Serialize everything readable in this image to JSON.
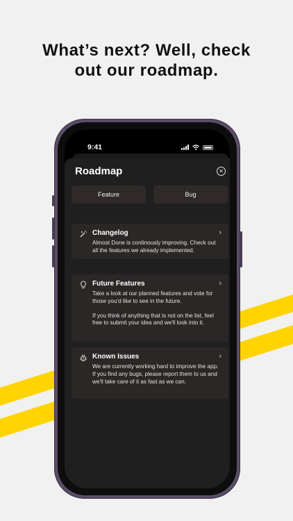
{
  "headline": {
    "line1": "What’s next? Well, check",
    "line2": "out our roadmap."
  },
  "colors": {
    "background": "#f1f1f1",
    "stripe": "#ffd400",
    "phone_frame": "#5a4d66",
    "sheet": "#1f1f1f",
    "card": "#2b2726"
  },
  "status_bar": {
    "time": "9:41",
    "icons": [
      "cellular-signal-icon",
      "wifi-icon",
      "battery-icon"
    ]
  },
  "sheet": {
    "title": "Roadmap",
    "close_icon": "close-circle-icon",
    "segments": [
      "Feature",
      "Bug"
    ],
    "cards": [
      {
        "icon": "magic-wand-icon",
        "title": "Changelog",
        "paragraphs": [
          "Almost Done is continously improving. Check out all the features we already implemented."
        ]
      },
      {
        "icon": "lightbulb-icon",
        "title": "Future Features",
        "paragraphs": [
          "Take a look at our planned features and vote for those you'd like to see in the future.",
          "If you think of anything that is not on the list, feel free to submit your idea and we'll look into it."
        ]
      },
      {
        "icon": "bug-icon",
        "title": "Known Issues",
        "paragraphs": [
          "We are currently working hard to improve the app. If you find any bugs, please report them to us and we'll take care of it as fast as we can."
        ]
      }
    ]
  }
}
